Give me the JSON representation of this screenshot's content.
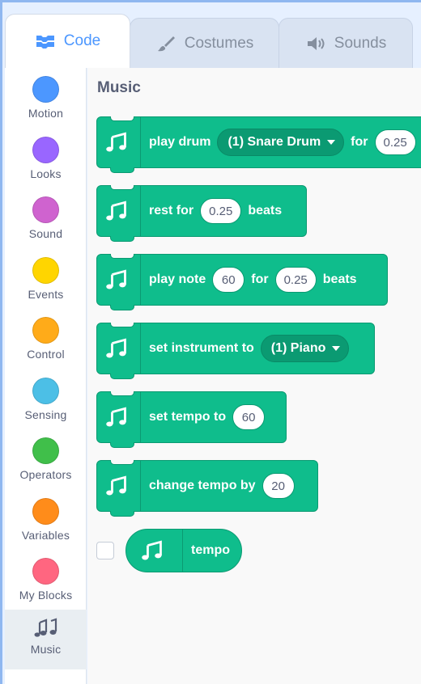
{
  "tabs": [
    {
      "label": "Code",
      "icon": "code-blocks-icon",
      "active": true
    },
    {
      "label": "Costumes",
      "icon": "paintbrush-icon",
      "active": false
    },
    {
      "label": "Sounds",
      "icon": "speaker-icon",
      "active": false
    }
  ],
  "categories": [
    {
      "label": "Motion",
      "color": "#4c97ff"
    },
    {
      "label": "Looks",
      "color": "#9966ff"
    },
    {
      "label": "Sound",
      "color": "#cf63cf"
    },
    {
      "label": "Events",
      "color": "#ffd500"
    },
    {
      "label": "Control",
      "color": "#ffab19"
    },
    {
      "label": "Sensing",
      "color": "#4cbfe6"
    },
    {
      "label": "Operators",
      "color": "#40bf4a"
    },
    {
      "label": "Variables",
      "color": "#ff8c1a"
    },
    {
      "label": "My Blocks",
      "color": "#ff6680"
    },
    {
      "label": "Music",
      "icon": "music-notes-icon",
      "selected": true
    }
  ],
  "palette": {
    "title": "Music",
    "block_color": "#0fbd8c",
    "blocks": {
      "play_drum": {
        "text1": "play drum",
        "dropdown": "(1) Snare Drum",
        "text2": "for",
        "value": "0.25"
      },
      "rest": {
        "text1": "rest for",
        "value": "0.25",
        "text2": "beats"
      },
      "play_note": {
        "text1": "play note",
        "note": "60",
        "text2": "for",
        "value": "0.25",
        "text3": "beats"
      },
      "set_instrument": {
        "text1": "set instrument to",
        "dropdown": "(1) Piano"
      },
      "set_tempo": {
        "text1": "set tempo to",
        "value": "60"
      },
      "change_tempo": {
        "text1": "change tempo by",
        "value": "20"
      },
      "tempo_reporter": {
        "text1": "tempo"
      }
    }
  }
}
